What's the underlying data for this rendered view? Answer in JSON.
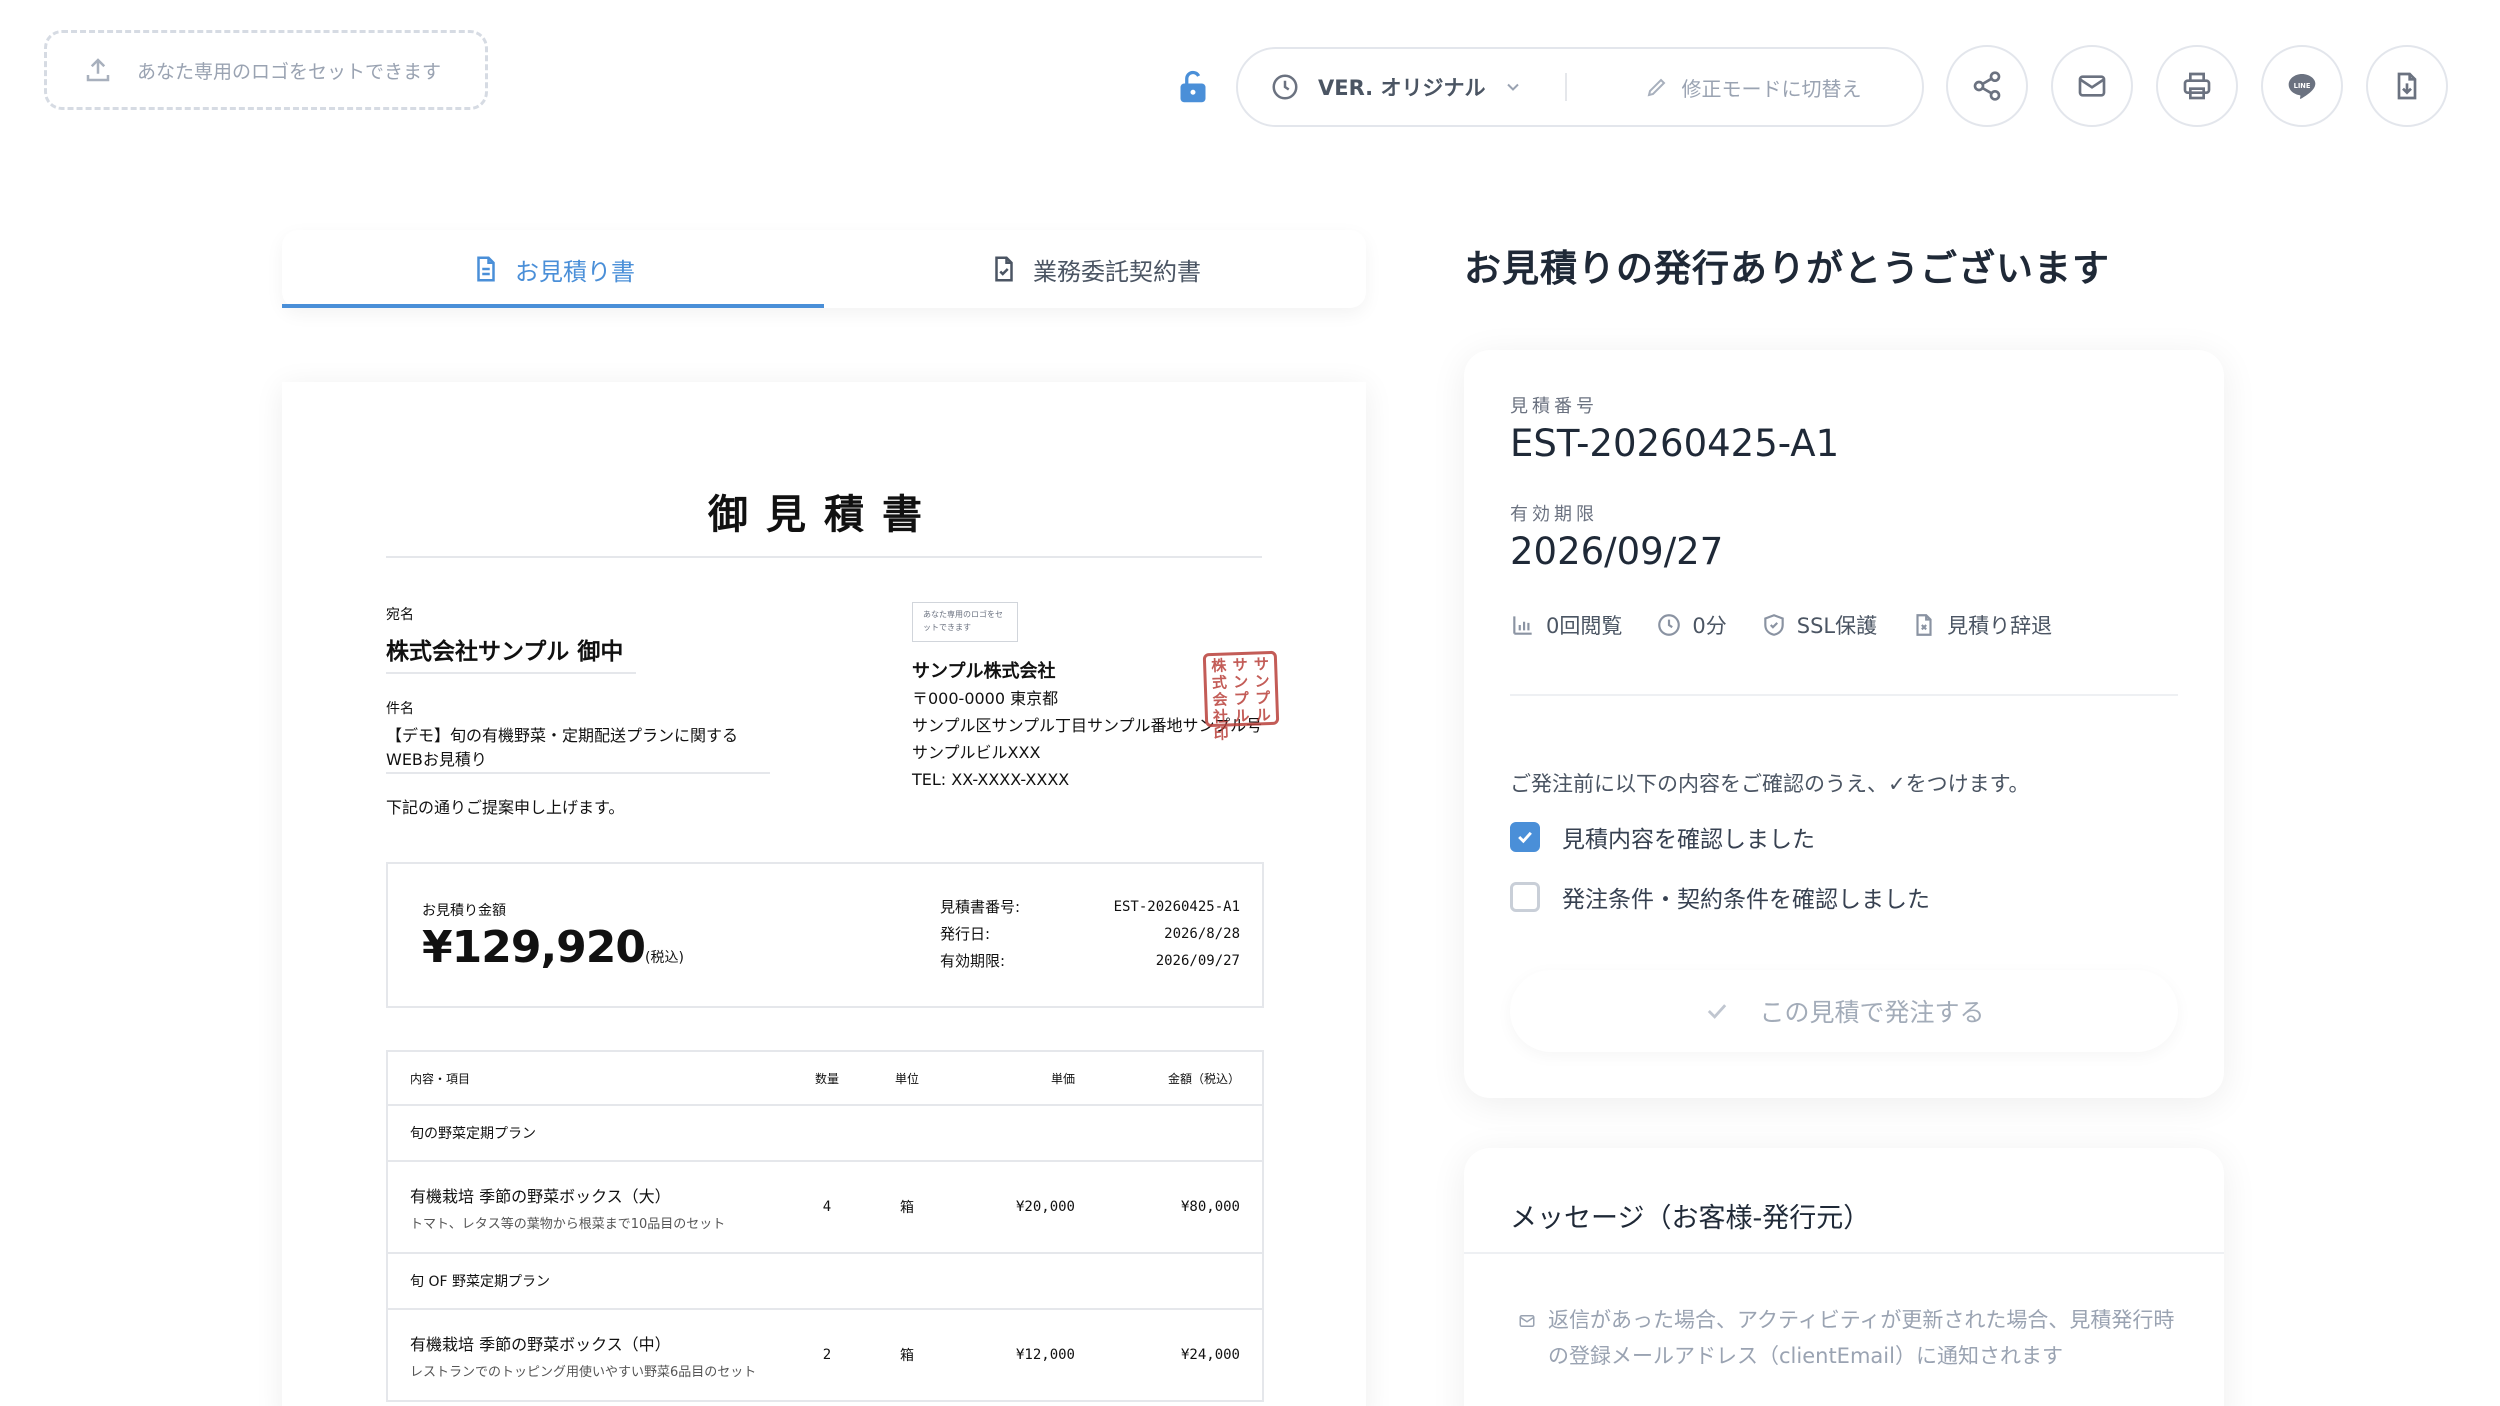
{
  "topbar": {
    "logo_placeholder": "あなた専用のロゴをセットできます",
    "version_label": "VER. オリジナル",
    "edit_mode_label": "修正モードに切替え"
  },
  "tabs": [
    {
      "label": "お見積り書",
      "active": true
    },
    {
      "label": "業務委託契約書",
      "active": false
    }
  ],
  "document": {
    "title": "御見積書",
    "to_label": "宛名",
    "to_name": "株式会社サンプル 御中",
    "subject_label": "件名",
    "subject": "【デモ】旬の有機野菜・定期配送プランに関するWEBお見積り",
    "proposal_text": "下記の通りご提案申し上げます。",
    "mini_logo_text": "あなた専用のロゴをセットできます",
    "issuer": {
      "name": "サンプル株式会社",
      "postal": "〒000-0000 東京都",
      "address1": "サンプル区サンプル丁目サンプル番地サンプル号",
      "address2": "サンプルビルXXX",
      "tel": "TEL: XX-XXXX-XXXX"
    },
    "stamp_text": [
      "株",
      "サ",
      "サ",
      "式",
      "ン",
      "ン",
      "会",
      "プ",
      "プ",
      "社",
      "ル",
      "ル",
      "印",
      "",
      ""
    ],
    "total_label": "お見積り金額",
    "total_amount": "¥129,920",
    "total_tax": "(税込)",
    "meta": [
      {
        "k": "見積書番号:",
        "v": "EST-20260425-A1"
      },
      {
        "k": "発行日:",
        "v": "2026/8/28"
      },
      {
        "k": "有効期限:",
        "v": "2026/09/27"
      }
    ],
    "table_headers": {
      "item": "内容・項目",
      "qty": "数量",
      "unit": "単位",
      "price": "単価",
      "amount": "金額（税込）"
    },
    "sections": [
      {
        "title": "旬の野菜定期プラン",
        "name": "有機栽培 季節の野菜ボックス（大）",
        "desc": "トマト、レタス等の葉物から根菜まで10品目のセット",
        "qty": "4",
        "unit": "箱",
        "price": "¥20,000",
        "amount": "¥80,000"
      },
      {
        "title": "旬 OF 野菜定期プラン",
        "name": "有機栽培 季節の野菜ボックス（中）",
        "desc": "レストランでのトッピング用使いやすい野菜6品目のセット",
        "qty": "2",
        "unit": "箱",
        "price": "¥12,000",
        "amount": "¥24,000"
      }
    ]
  },
  "panel": {
    "thanks": "お見積りの発行ありがとうございます",
    "estimate_no_label": "見積番号",
    "estimate_no": "EST-20260425-A1",
    "expiry_label": "有効期限",
    "expiry": "2026/09/27",
    "stats": {
      "views": "0回閲覧",
      "time": "0分",
      "ssl": "SSL保護",
      "decline": "見積り辞退"
    },
    "confirm_note": "ご発注前に以下の内容をご確認のうえ、✓をつけます。",
    "checks": [
      {
        "label": "見積内容を確認しました",
        "checked": true
      },
      {
        "label": "発注条件・契約条件を確認しました",
        "checked": false
      }
    ],
    "order_button": "この見積で発注する",
    "message_title": "メッセージ（お客様-発行元）",
    "message_note": "返信があった場合、アクティビティが更新された場合、見積発行時の登録メールアドレス（clientEmail）に通知されます"
  },
  "colors": {
    "accent": "#4a8fd8",
    "stamp": "#b9403a"
  }
}
